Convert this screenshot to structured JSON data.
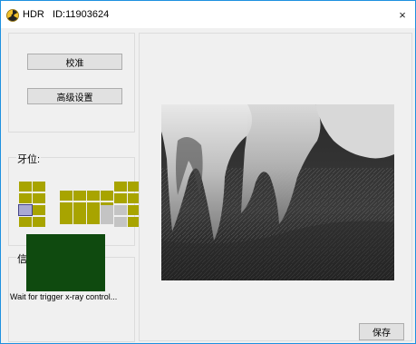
{
  "window": {
    "app_name": "HDR",
    "id_label": "ID:11903624",
    "close_glyph": "×",
    "accent_color": "#1e90e0"
  },
  "buttons": {
    "calibrate": "校准",
    "advanced_settings": "高级设置",
    "save": "保存"
  },
  "tooth_position": {
    "label": "牙位:",
    "upper_row": [
      "available",
      "available",
      "available",
      "available",
      "available",
      "available",
      "available",
      "available"
    ],
    "lower_row": [
      "selected",
      "available",
      "available",
      "available",
      "available",
      "unavailable",
      "unavailable",
      "available"
    ],
    "colors": {
      "available": "#a8a400",
      "unavailable": "#c4c4c4",
      "selected": "#a9a9d2"
    }
  },
  "info": {
    "label": "信息",
    "status_text": "Wait for trigger x-ray control...",
    "screen_color": "#0f4a0f"
  },
  "icons": {
    "title": "hdr-app-icon",
    "close": "close-icon"
  }
}
